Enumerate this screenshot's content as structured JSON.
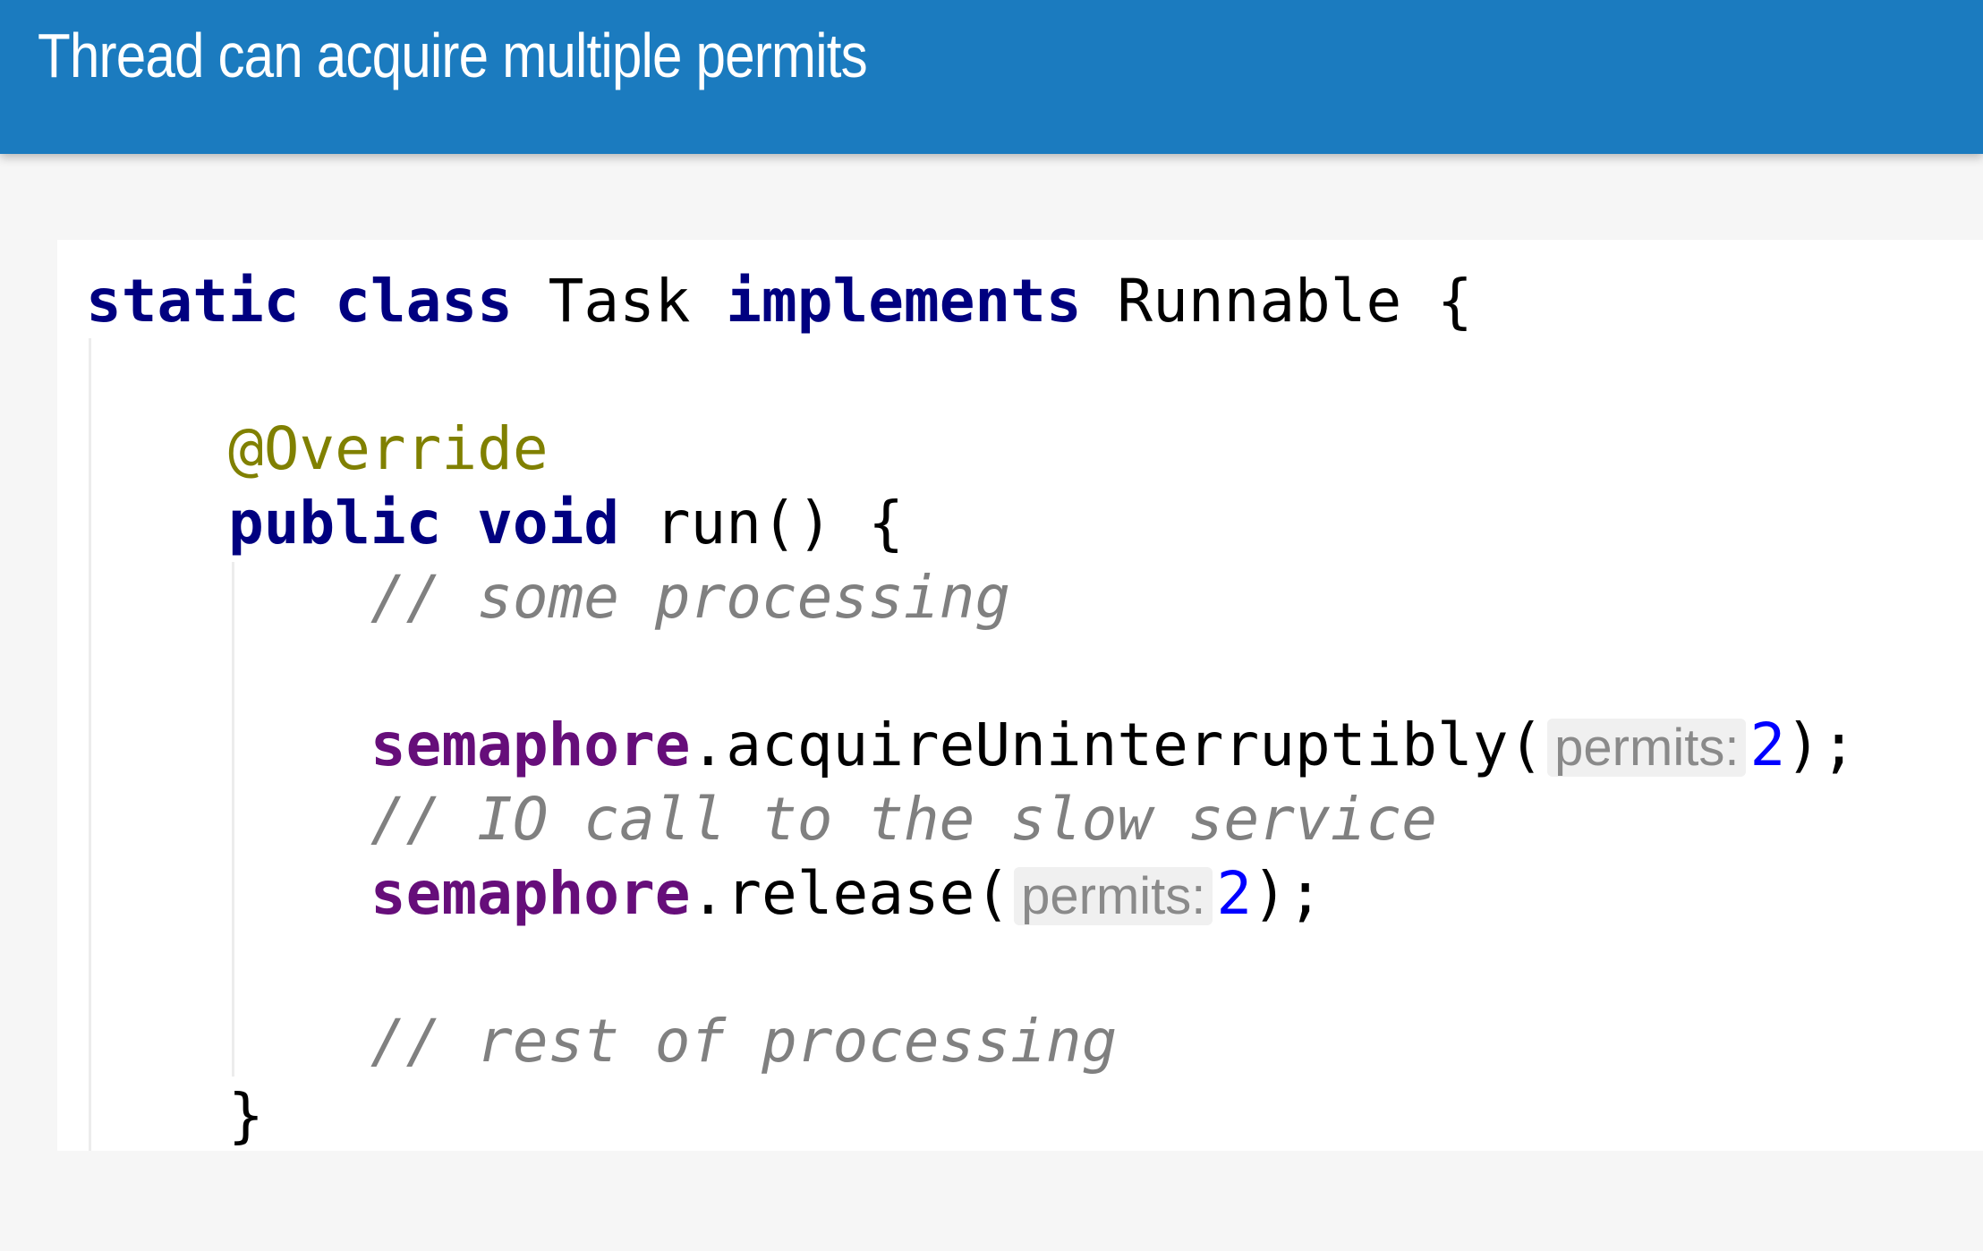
{
  "header": {
    "title": "Thread can acquire multiple permits"
  },
  "colors": {
    "header": "#1b7bbf",
    "keyword": "#000080",
    "field": "#660e7a",
    "comment": "#808080",
    "number": "#0000ff",
    "annotation": "#808000"
  },
  "code": {
    "lines": [
      [
        {
          "t": "kw",
          "v": "static"
        },
        {
          "t": "plain",
          "v": " "
        },
        {
          "t": "kw",
          "v": "class"
        },
        {
          "t": "plain",
          "v": " Task "
        },
        {
          "t": "kw",
          "v": "implements"
        },
        {
          "t": "plain",
          "v": " Runnable {"
        }
      ],
      [],
      [
        {
          "t": "plain",
          "v": "    "
        },
        {
          "t": "ann",
          "v": "@Override"
        }
      ],
      [
        {
          "t": "plain",
          "v": "    "
        },
        {
          "t": "kw",
          "v": "public"
        },
        {
          "t": "plain",
          "v": " "
        },
        {
          "t": "kw",
          "v": "void"
        },
        {
          "t": "plain",
          "v": " run() {"
        }
      ],
      [
        {
          "t": "plain",
          "v": "        "
        },
        {
          "t": "cm",
          "v": "// some processing"
        }
      ],
      [],
      [
        {
          "t": "plain",
          "v": "        "
        },
        {
          "t": "field",
          "v": "semaphore"
        },
        {
          "t": "plain",
          "v": ".acquireUninterruptibly("
        },
        {
          "t": "hint",
          "v": "permits:"
        },
        {
          "t": "num",
          "v": "2"
        },
        {
          "t": "plain",
          "v": ");"
        }
      ],
      [
        {
          "t": "plain",
          "v": "        "
        },
        {
          "t": "cm",
          "v": "// IO call to the slow service"
        }
      ],
      [
        {
          "t": "plain",
          "v": "        "
        },
        {
          "t": "field",
          "v": "semaphore"
        },
        {
          "t": "plain",
          "v": ".release("
        },
        {
          "t": "hint",
          "v": "permits:"
        },
        {
          "t": "num",
          "v": "2"
        },
        {
          "t": "plain",
          "v": ");"
        }
      ],
      [],
      [
        {
          "t": "plain",
          "v": "        "
        },
        {
          "t": "cm",
          "v": "// rest of processing"
        }
      ],
      [
        {
          "t": "plain",
          "v": "    }"
        }
      ]
    ]
  }
}
